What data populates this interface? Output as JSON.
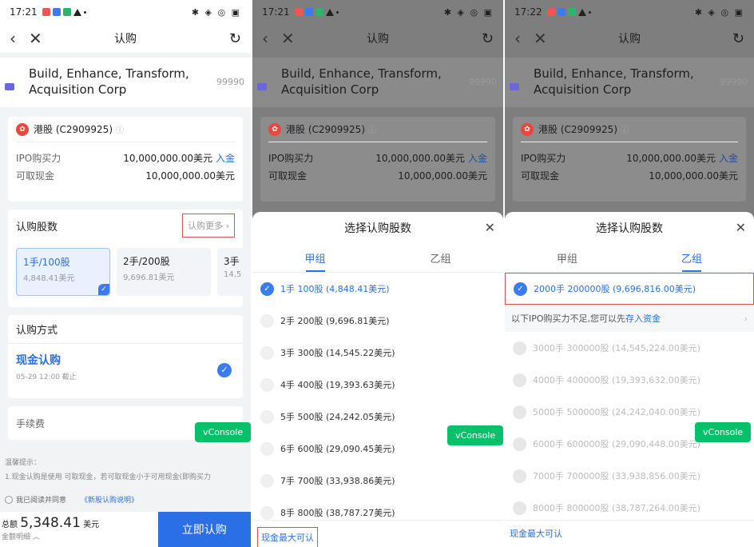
{
  "panels": [
    {
      "status_time": "17:21",
      "status_right": "✱ ◈ ◎ ▣",
      "title": "认购",
      "stock_name": "Build, Enhance, Transform, Acquisition Corp",
      "stock_code": "99990",
      "account": "港股 (C2909925)",
      "ipo_power_label": "IPO购买力",
      "ipo_power_value": "10,000,000.00美元",
      "deposit_link": "入金",
      "cash_label": "可取现金",
      "cash_value": "10,000,000.00美元"
    },
    {
      "status_time": "17:21",
      "status_right": "✱ ◈ ◎ ▣",
      "title": "认购",
      "stock_name": "Build, Enhance, Transform, Acquisition Corp",
      "stock_code": "99990",
      "account": "港股 (C2909925)",
      "ipo_power_label": "IPO购买力",
      "ipo_power_value": "10,000,000.00美元",
      "deposit_link": "入金",
      "cash_label": "可取现金",
      "cash_value": "10,000,000.00美元"
    },
    {
      "status_time": "17:22",
      "status_right": "✱ ◈ ◎ ▣",
      "title": "认购",
      "stock_name": "Build, Enhance, Transform, Acquisition Corp",
      "stock_code": "99990",
      "account": "港股 (C2909925)",
      "ipo_power_label": "IPO购买力",
      "ipo_power_value": "10,000,000.00美元",
      "deposit_link": "入金",
      "cash_label": "可取现金",
      "cash_value": "10,000,000.00美元"
    }
  ],
  "p1": {
    "shares_label": "认购股数",
    "more_button": "认购更多",
    "chips": [
      {
        "lots": "1手/100股",
        "amount": "4,848.41美元"
      },
      {
        "lots": "2手/200股",
        "amount": "9,696.81美元"
      },
      {
        "lots": "3手",
        "amount": "14,5"
      }
    ],
    "method_label": "认购方式",
    "cash_method": "现金认购",
    "deadline": "05-29 12:00 截止",
    "fee_label": "手续费",
    "tips_title": "温馨提示：",
    "tips_text": "1.现金认购是使用 可取现金，若可取现金小于可用现金(即购买力",
    "agree_text": "我已阅读并同意",
    "agree_link": "《新股认购说明》",
    "total_label": "总额",
    "total_value": "5,348.41",
    "total_unit": "美元",
    "detail_link": "金额明细 ︿",
    "buy_button": "立即认购",
    "vconsole": "vConsole"
  },
  "p2": {
    "sheet_title": "选择认购股数",
    "tab_a": "甲组",
    "tab_b": "乙组",
    "options": [
      "1手 100股 (4,848.41美元)",
      "2手 200股 (9,696.81美元)",
      "3手 300股 (14,545.22美元)",
      "4手 400股 (19,393.63美元)",
      "5手 500股 (24,242.05美元)",
      "6手 600股 (29,090.45美元)",
      "7手 700股 (33,938.86美元)",
      "8手 800股 (38,787.27美元)"
    ],
    "footer": "现金最大可认",
    "vconsole": "vConsole"
  },
  "p3": {
    "sheet_title": "选择认购股数",
    "tab_a": "甲组",
    "tab_b": "乙组",
    "selected": "2000手 200000股 (9,696,816.00美元)",
    "notice": "以下IPO购买力不足,您可以先",
    "notice_link": "存入资金",
    "options": [
      "3000手 300000股 (14,545,224.00美元)",
      "4000手 400000股 (19,393,632.00美元)",
      "5000手 500000股 (24,242,040.00美元)",
      "6000手 600000股 (29,090,448.00美元)",
      "7000手 700000股 (33,938,856.00美元)",
      "8000手 800000股 (38,787,264.00美元)"
    ],
    "footer": "现金最大可认",
    "vconsole": "vConsole"
  }
}
